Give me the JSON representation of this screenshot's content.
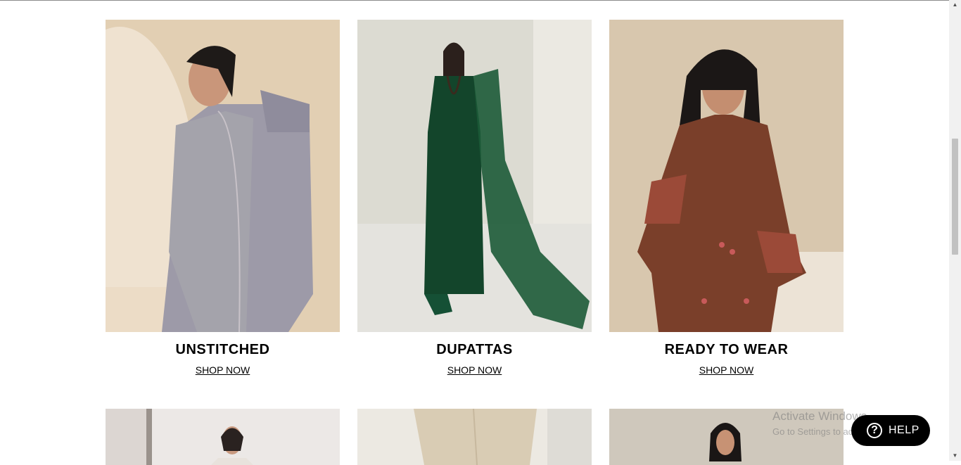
{
  "categories": [
    {
      "title": "UNSTITCHED",
      "cta": "SHOP NOW",
      "image": "model in grey embroidered suit with grey shawl"
    },
    {
      "title": "DUPATTAS",
      "cta": "SHOP NOW",
      "image": "model in green chiffon dress with green dupatta"
    },
    {
      "title": "READY TO WEAR",
      "cta": "SHOP NOW",
      "image": "model in brown embroidered kurta"
    }
  ],
  "row2": [
    {
      "image": "model in light outfit"
    },
    {
      "image": "beige trousers"
    },
    {
      "image": "model in black and white outfit"
    }
  ],
  "watermark": {
    "line1": "Activate Windows",
    "line2": "Go to Settings to activate Windows."
  },
  "help": {
    "label": "HELP",
    "icon": "question-icon"
  },
  "colors": {
    "help_bg": "#000000",
    "text": "#000000"
  }
}
